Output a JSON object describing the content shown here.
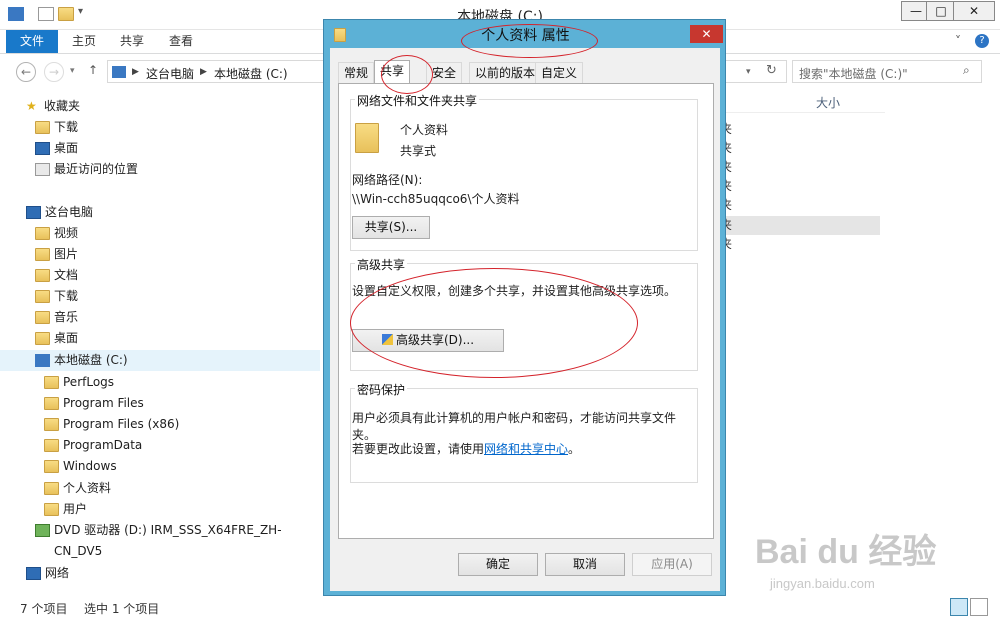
{
  "explorer": {
    "title": "本地磁盘 (C:)",
    "window_buttons": {
      "minimize": "—",
      "maximize": "□",
      "close": "✕"
    },
    "ribbon_tabs": [
      "文件",
      "主页",
      "共享",
      "查看"
    ],
    "address_parts": [
      "这台电脑",
      "本地磁盘 (C:)"
    ],
    "search_placeholder": "搜索\"本地磁盘 (C:)\"",
    "nav": {
      "favorites": {
        "label": "收藏夹",
        "items": [
          "下载",
          "桌面",
          "最近访问的位置"
        ]
      },
      "this_pc": {
        "label": "这台电脑",
        "items": [
          "视频",
          "图片",
          "文档",
          "下载",
          "音乐",
          "桌面"
        ]
      },
      "drive_c": {
        "label": "本地磁盘 (C:)",
        "items": [
          "PerfLogs",
          "Program Files",
          "Program Files (x86)",
          "ProgramData",
          "Windows",
          "个人资料",
          "用户"
        ]
      },
      "dvd": "DVD 驱动器 (D:) IRM_SSS_X64FRE_ZH-CN_DV5",
      "network": "网络"
    },
    "column_size": "大小",
    "file_rows": [
      "夹",
      "夹",
      "夹",
      "夹",
      "夹",
      "夹",
      "夹"
    ],
    "status_count": "7 个项目",
    "status_selected": "选中 1 个项目"
  },
  "dialog": {
    "title": "个人资料 属性",
    "tabs": [
      "常规",
      "共享",
      "安全",
      "以前的版本",
      "自定义"
    ],
    "active_tab": "共享",
    "network_share": {
      "heading": "网络文件和文件夹共享",
      "folder_name": "个人资料",
      "share_state": "共享式",
      "path_label": "网络路径(N):",
      "path_value": "\\\\Win-cch85uqqco6\\个人资料",
      "share_button": "共享(S)..."
    },
    "advanced": {
      "heading": "高级共享",
      "description": "设置自定义权限，创建多个共享，并设置其他高级共享选项。",
      "button": "高级共享(D)..."
    },
    "password": {
      "heading": "密码保护",
      "line1": "用户必须具有此计算机的用户帐户和密码，才能访问共享文件夹。",
      "line2_prefix": "若要更改此设置，请使用",
      "line2_link": "网络和共享中心",
      "line2_suffix": "。"
    },
    "buttons": {
      "ok": "确定",
      "cancel": "取消",
      "apply": "应用(A)"
    }
  },
  "watermark": {
    "brand": "Bai du 经验",
    "url": "jingyan.baidu.com"
  },
  "colors": {
    "accent": "#1979ca",
    "dialog_frame": "#5cb1d6",
    "annotation": "#d4232b",
    "link": "#0066cc"
  }
}
